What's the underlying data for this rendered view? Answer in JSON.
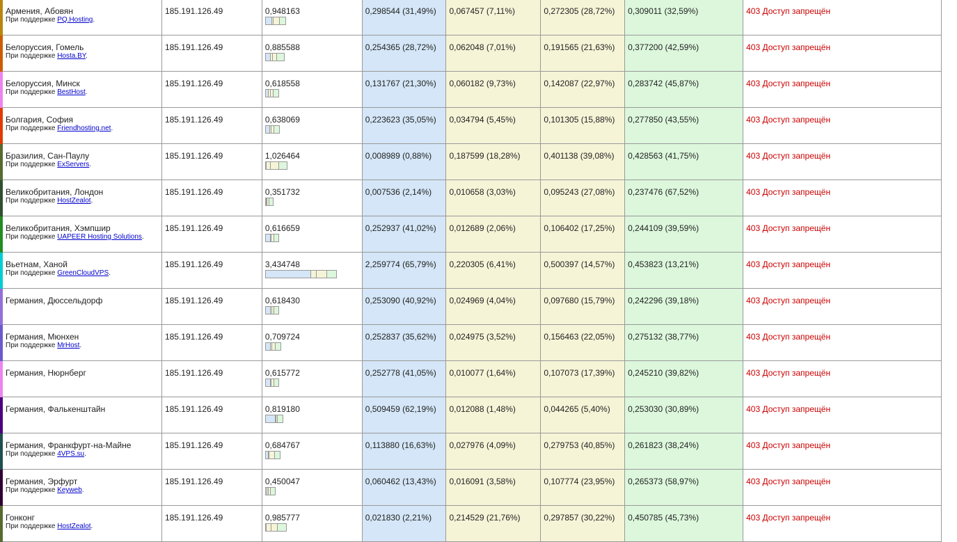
{
  "rows": [
    {
      "city": "Армения, Абовян",
      "support_prefix": "При поддержке ",
      "provider": "PQ.Hosting",
      "ip": "185.191.126.49",
      "total": "0,948163",
      "total_num": 0.948163,
      "dns": "0,298544 (31,49%)",
      "connect": "0,067457 (7,11%)",
      "ttfb": "0,272305 (28,72%)",
      "download": "0,309011 (32,59%)",
      "result": "403 Доступ запрещён",
      "color": "#b8860b",
      "p": [
        31.49,
        7.11,
        28.72,
        32.59
      ]
    },
    {
      "city": "Белоруссия, Гомель",
      "support_prefix": "При поддержке ",
      "provider": "Hosta.BY",
      "ip": "185.191.126.49",
      "total": "0,885588",
      "total_num": 0.885588,
      "dns": "0,254365 (28,72%)",
      "connect": "0,062048 (7,01%)",
      "ttfb": "0,191565 (21,63%)",
      "download": "0,377200 (42,59%)",
      "result": "403 Доступ запрещён",
      "color": "#cd5c00",
      "p": [
        28.72,
        7.01,
        21.63,
        42.59
      ]
    },
    {
      "city": "Белоруссия, Минск",
      "support_prefix": "При поддержке ",
      "provider": "BestHost",
      "ip": "185.191.126.49",
      "total": "0,618558",
      "total_num": 0.618558,
      "dns": "0,131767 (21,30%)",
      "connect": "0,060182 (9,73%)",
      "ttfb": "0,142087 (22,97%)",
      "download": "0,283742 (45,87%)",
      "result": "403 Доступ запрещён",
      "color": "#ee82ee",
      "p": [
        21.3,
        9.73,
        22.97,
        45.87
      ]
    },
    {
      "city": "Болгария, София",
      "support_prefix": "При поддержке ",
      "provider": "Friendhosting.net",
      "ip": "185.191.126.49",
      "total": "0,638069",
      "total_num": 0.638069,
      "dns": "0,223623 (35,05%)",
      "connect": "0,034794 (5,45%)",
      "ttfb": "0,101305 (15,88%)",
      "download": "0,277850 (43,55%)",
      "result": "403 Доступ запрещён",
      "color": "#e03c00",
      "p": [
        35.05,
        5.45,
        15.88,
        43.55
      ]
    },
    {
      "city": "Бразилия, Сан-Паулу",
      "support_prefix": "При поддержке ",
      "provider": "ExServers",
      "ip": "185.191.126.49",
      "total": "1,026464",
      "total_num": 1.026464,
      "dns": "0,008989 (0,88%)",
      "connect": "0,187599 (18,28%)",
      "ttfb": "0,401138 (39,08%)",
      "download": "0,428563 (41,75%)",
      "result": "403 Доступ запрещён",
      "color": "#556b2f",
      "p": [
        0.88,
        18.28,
        39.08,
        41.75
      ]
    },
    {
      "city": "Великобритания, Лондон",
      "support_prefix": "При поддержке ",
      "provider": "HostZealot",
      "ip": "185.191.126.49",
      "total": "0,351732",
      "total_num": 0.351732,
      "dns": "0,007536 (2,14%)",
      "connect": "0,010658 (3,03%)",
      "ttfb": "0,095243 (27,08%)",
      "download": "0,237476 (67,52%)",
      "result": "403 Доступ запрещён",
      "color": "#2f4f2f",
      "p": [
        2.14,
        3.03,
        27.08,
        67.52
      ]
    },
    {
      "city": "Великобритания, Хэмпшир",
      "support_prefix": "При поддержке ",
      "provider": "UAPEER Hosting Solutions",
      "ip": "185.191.126.49",
      "total": "0,616659",
      "total_num": 0.616659,
      "dns": "0,252937 (41,02%)",
      "connect": "0,012689 (2,06%)",
      "ttfb": "0,106402 (17,25%)",
      "download": "0,244109 (39,59%)",
      "result": "403 Доступ запрещён",
      "color": "#228b22",
      "p": [
        41.02,
        2.06,
        17.25,
        39.59
      ]
    },
    {
      "city": "Вьетнам, Ханой",
      "support_prefix": "При поддержке ",
      "provider": "GreenCloudVPS",
      "ip": "185.191.126.49",
      "total": "3,434748",
      "total_num": 3.434748,
      "dns": "2,259774 (65,79%)",
      "connect": "0,220305 (6,41%)",
      "ttfb": "0,500397 (14,57%)",
      "download": "0,453823 (13,21%)",
      "result": "403 Доступ запрещён",
      "color": "#00ced1",
      "p": [
        65.79,
        6.41,
        14.57,
        13.21
      ]
    },
    {
      "city": "Германия, Дюссельдорф",
      "support_prefix": "",
      "provider": "",
      "ip": "185.191.126.49",
      "total": "0,618430",
      "total_num": 0.61843,
      "dns": "0,253090 (40,92%)",
      "connect": "0,024969 (4,04%)",
      "ttfb": "0,097680 (15,79%)",
      "download": "0,242296 (39,18%)",
      "result": "403 Доступ запрещён",
      "color": "#9370db",
      "p": [
        40.92,
        4.04,
        15.79,
        39.18
      ]
    },
    {
      "city": "Германия, Мюнхен",
      "support_prefix": "При поддержке ",
      "provider": "MrHost",
      "ip": "185.191.126.49",
      "total": "0,709724",
      "total_num": 0.709724,
      "dns": "0,252837 (35,62%)",
      "connect": "0,024975 (3,52%)",
      "ttfb": "0,156463 (22,05%)",
      "download": "0,275132 (38,77%)",
      "result": "403 Доступ запрещён",
      "color": "#6a5acd",
      "p": [
        35.62,
        3.52,
        22.05,
        38.77
      ]
    },
    {
      "city": "Германия, Нюрнберг",
      "support_prefix": "",
      "provider": "",
      "ip": "185.191.126.49",
      "total": "0,615772",
      "total_num": 0.615772,
      "dns": "0,252778 (41,05%)",
      "connect": "0,010077 (1,64%)",
      "ttfb": "0,107073 (17,39%)",
      "download": "0,245210 (39,82%)",
      "result": "403 Доступ запрещён",
      "color": "#ee82ee",
      "p": [
        41.05,
        1.64,
        17.39,
        39.82
      ]
    },
    {
      "city": "Германия, Фалькенштайн",
      "support_prefix": "",
      "provider": "",
      "ip": "185.191.126.49",
      "total": "0,819180",
      "total_num": 0.81918,
      "dns": "0,509459 (62,19%)",
      "connect": "0,012088 (1,48%)",
      "ttfb": "0,044265 (5,40%)",
      "download": "0,253030 (30,89%)",
      "result": "403 Доступ запрещён",
      "color": "#4b0082",
      "p": [
        62.19,
        1.48,
        5.4,
        30.89
      ]
    },
    {
      "city": "Германия, Франкфурт-на-Майне",
      "support_prefix": "При поддержке ",
      "provider": "4VPS.su",
      "ip": "185.191.126.49",
      "total": "0,684767",
      "total_num": 0.684767,
      "dns": "0,113880 (16,63%)",
      "connect": "0,027976 (4,09%)",
      "ttfb": "0,279753 (40,85%)",
      "download": "0,261823 (38,24%)",
      "result": "403 Доступ запрещён",
      "color": "#1f4f4f",
      "p": [
        16.63,
        4.09,
        40.85,
        38.24
      ]
    },
    {
      "city": "Германия, Эрфурт",
      "support_prefix": "При поддержке ",
      "provider": "Keyweb",
      "ip": "185.191.126.49",
      "total": "0,450047",
      "total_num": 0.450047,
      "dns": "0,060462 (13,43%)",
      "connect": "0,016091 (3,58%)",
      "ttfb": "0,107774 (23,95%)",
      "download": "0,265373 (58,97%)",
      "result": "403 Доступ запрещён",
      "color": "#2e0033",
      "p": [
        13.43,
        3.58,
        23.95,
        58.97
      ]
    },
    {
      "city": "Гонконг",
      "support_prefix": "При поддержке ",
      "provider": "HostZealot",
      "ip": "185.191.126.49",
      "total": "0,985777",
      "total_num": 0.985777,
      "dns": "0,021830 (2,21%)",
      "connect": "0,214529 (21,76%)",
      "ttfb": "0,297857 (30,22%)",
      "download": "0,450785 (45,73%)",
      "result": "403 Доступ запрещён",
      "color": "#556b2f",
      "p": [
        2.21,
        21.76,
        30.22,
        45.73
      ]
    }
  ]
}
